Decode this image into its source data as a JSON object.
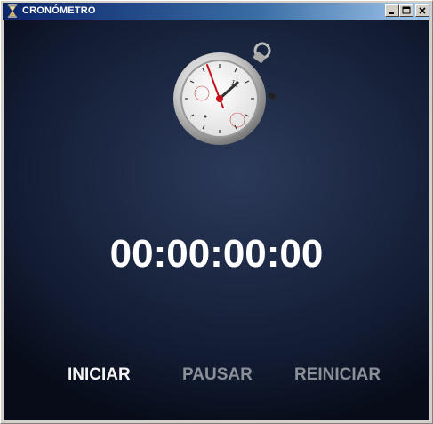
{
  "window": {
    "title": "CRONÓMETRO",
    "icon": "hourglass-icon",
    "controls": [
      "minimize-icon",
      "maximize-icon",
      "close-icon"
    ]
  },
  "stopwatch": {
    "icon": "stopwatch-icon",
    "dial_label": "12"
  },
  "display": {
    "time": "00:00:00:00"
  },
  "controls": {
    "start_label": "INICIAR",
    "pause_label": "PAUSAR",
    "reset_label": "REINICIAR"
  },
  "colors": {
    "active_button": "#f4f4f4",
    "disabled_button": "#8a8f98",
    "background": "#1d2944",
    "second_hand": "#c8101e"
  }
}
